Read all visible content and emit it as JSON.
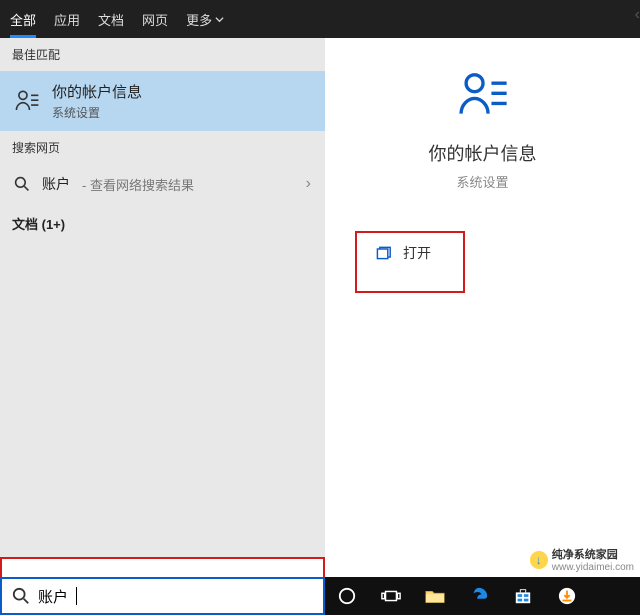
{
  "tabs": {
    "all": "全部",
    "apps": "应用",
    "docs": "文档",
    "web": "网页",
    "more": "更多"
  },
  "left": {
    "best_match_header": "最佳匹配",
    "best_match": {
      "title": "你的帐户信息",
      "subtitle": "系统设置"
    },
    "search_web_header": "搜索网页",
    "web_item": {
      "term": "账户",
      "suffix": " - 查看网络搜索结果"
    },
    "documents_header": "文档 (1+)"
  },
  "right": {
    "title": "你的帐户信息",
    "subtitle": "系统设置",
    "open_label": "打开"
  },
  "search": {
    "value": "账户"
  },
  "watermark": {
    "text": "纯净系统家园",
    "url": "www.yidaimei.com"
  }
}
